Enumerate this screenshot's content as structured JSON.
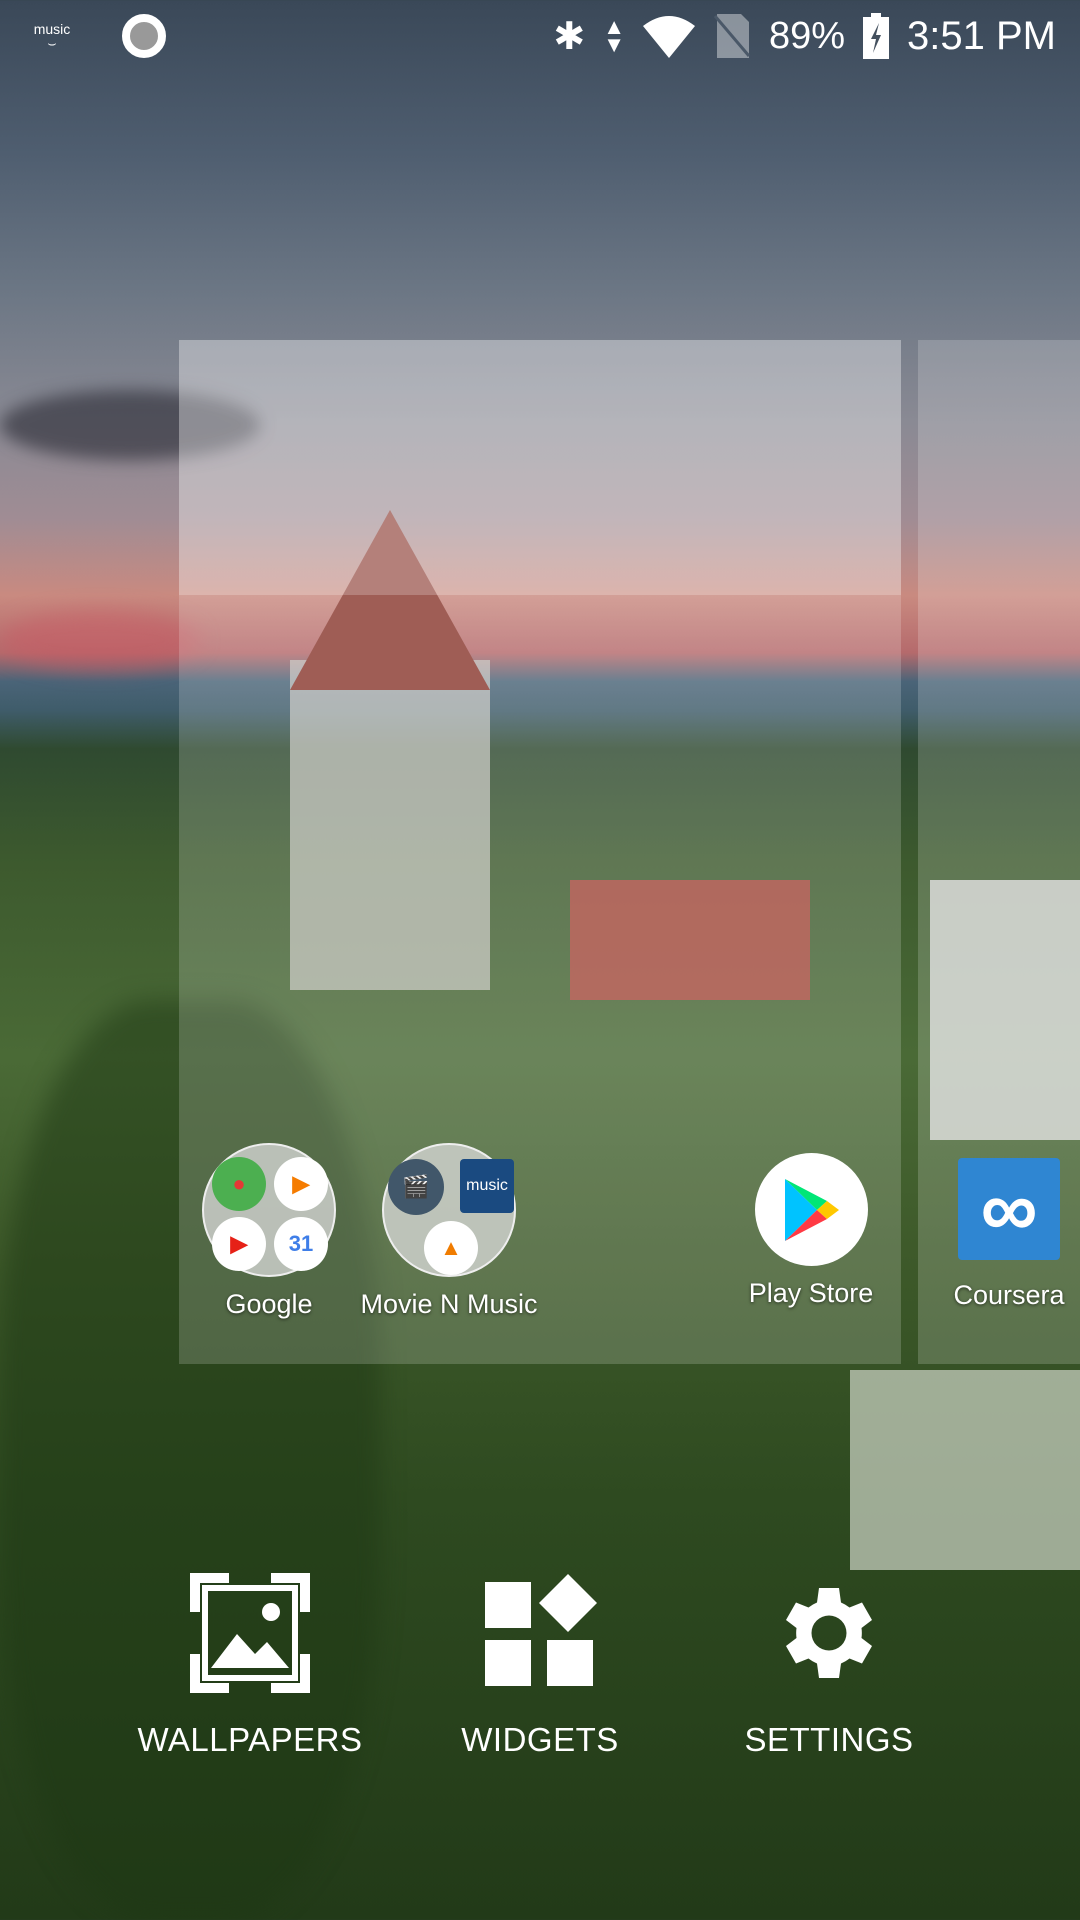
{
  "status_bar": {
    "left_icons": [
      "amazon-music-icon",
      "record-icon"
    ],
    "amazon_music_text": "music",
    "battery": "89%",
    "time": "3:51 PM",
    "icons": [
      "bluetooth-icon",
      "data-arrows-icon",
      "wifi-icon",
      "no-sim-icon",
      "battery-charging-icon"
    ]
  },
  "apps": [
    {
      "label": "Google",
      "type": "folder",
      "contents": [
        "Maps",
        "Play Music",
        "YouTube",
        "Calendar"
      ],
      "calendar_day": "31"
    },
    {
      "label": "Movie N Music",
      "type": "folder",
      "contents": [
        "Video",
        "Amazon Music",
        "VLC"
      ],
      "music_text": "music"
    },
    {
      "label": "Play Store",
      "type": "app"
    },
    {
      "label": "Coursera",
      "type": "app"
    }
  ],
  "options": [
    {
      "label": "WALLPAPERS",
      "icon": "wallpaper-icon"
    },
    {
      "label": "WIDGETS",
      "icon": "widgets-icon"
    },
    {
      "label": "SETTINGS",
      "icon": "gear-icon"
    }
  ]
}
